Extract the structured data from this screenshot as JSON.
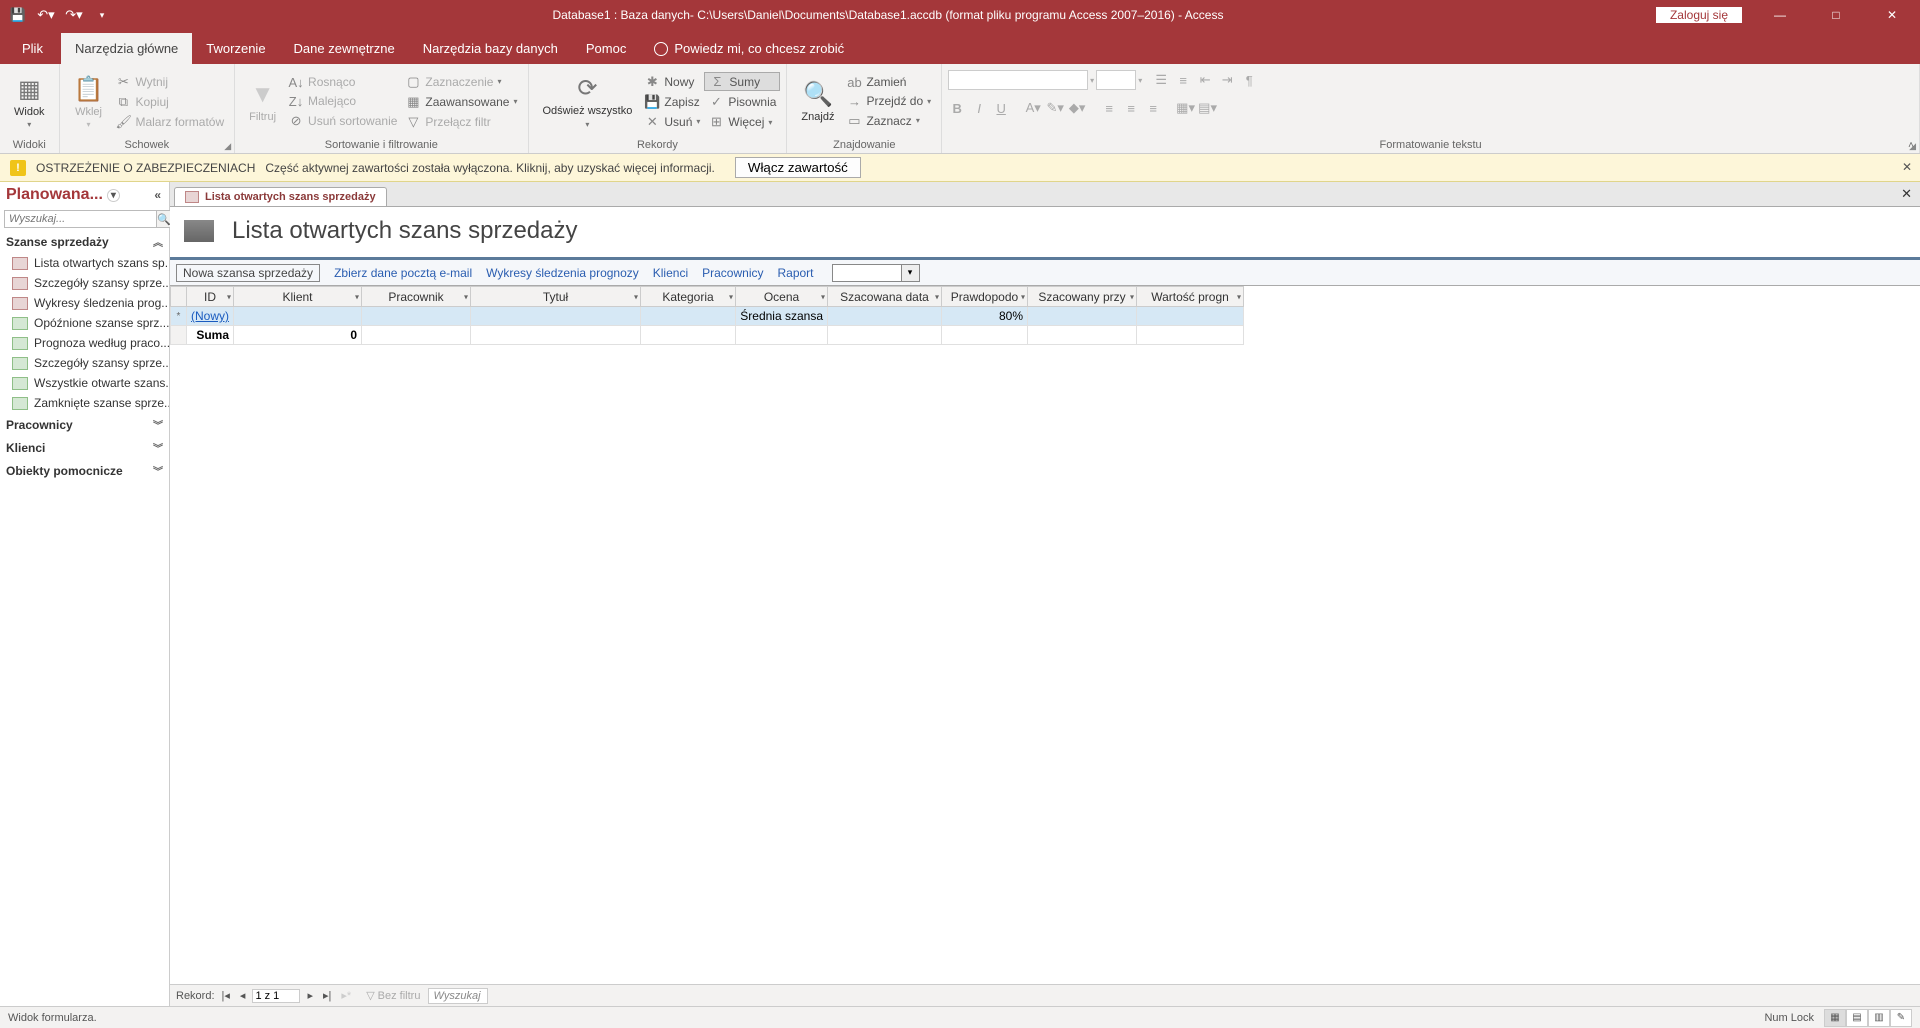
{
  "titlebar": {
    "title": "Database1 : Baza danych- C:\\Users\\Daniel\\Documents\\Database1.accdb (format pliku programu Access 2007–2016)  -  Access",
    "login": "Zaloguj się"
  },
  "tabs": {
    "file": "Plik",
    "home": "Narzędzia główne",
    "create": "Tworzenie",
    "external": "Dane zewnętrzne",
    "dbtools": "Narzędzia bazy danych",
    "help": "Pomoc",
    "tell": "Powiedz mi, co chcesz zrobić"
  },
  "ribbon": {
    "views": {
      "view": "Widok",
      "label": "Widoki"
    },
    "clipboard": {
      "paste": "Wklej",
      "cut": "Wytnij",
      "copy": "Kopiuj",
      "painter": "Malarz formatów",
      "label": "Schowek"
    },
    "sort": {
      "filter": "Filtruj",
      "asc": "Rosnąco",
      "desc": "Malejąco",
      "remove": "Usuń sortowanie",
      "selection": "Zaznaczenie",
      "advanced": "Zaawansowane",
      "toggle": "Przełącz filtr",
      "label": "Sortowanie i filtrowanie"
    },
    "records": {
      "refresh": "Odśwież wszystko",
      "new": "Nowy",
      "save": "Zapisz",
      "delete": "Usuń",
      "totals": "Sumy",
      "spelling": "Pisownia",
      "more": "Więcej",
      "label": "Rekordy"
    },
    "find": {
      "find": "Znajdź",
      "replace": "Zamień",
      "goto": "Przejdź do",
      "select": "Zaznacz",
      "label": "Znajdowanie"
    },
    "textfmt": {
      "label": "Formatowanie tekstu"
    }
  },
  "security": {
    "title": "OSTRZEŻENIE O ZABEZPIECZENIACH",
    "msg": "Część aktywnej zawartości została wyłączona. Kliknij, aby uzyskać więcej informacji.",
    "button": "Włącz zawartość"
  },
  "nav": {
    "header": "Planowana...",
    "search_ph": "Wyszukaj...",
    "sections": {
      "szanse": "Szanse sprzedaży",
      "pracownicy": "Pracownicy",
      "klienci": "Klienci",
      "obiekty": "Obiekty pomocnicze"
    },
    "items": [
      "Lista otwartych szans sp...",
      "Szczegóły szansy sprze...",
      "Wykresy śledzenia prog...",
      "Opóźnione szanse sprz...",
      "Prognoza według praco...",
      "Szczegóły szansy sprze...",
      "Wszystkie otwarte szans...",
      "Zamknięte szanse sprze..."
    ]
  },
  "doc": {
    "tab": "Lista otwartych szans sprzedaży",
    "title": "Lista otwartych szans sprzedaży",
    "toolbar": {
      "new": "Nowa szansa sprzedaży",
      "email": "Zbierz dane pocztą e-mail",
      "charts": "Wykresy śledzenia prognozy",
      "klienci": "Klienci",
      "pracownicy": "Pracownicy",
      "raport": "Raport"
    },
    "columns": [
      "ID",
      "Klient",
      "Pracownik",
      "Tytuł",
      "Kategoria",
      "Ocena",
      "Szacowana data",
      "Prawdopodo",
      "Szacowany przy",
      "Wartość progn"
    ],
    "newrow": {
      "id": "(Nowy)",
      "ocena": "Średnia szansa",
      "prob": "80%"
    },
    "total": {
      "label": "Suma",
      "klient": "0"
    }
  },
  "recnav": {
    "label": "Rekord:",
    "pos": "1 z 1",
    "nofilter": "Bez filtru",
    "search": "Wyszukaj"
  },
  "status": {
    "left": "Widok formularza.",
    "numlock": "Num Lock"
  }
}
